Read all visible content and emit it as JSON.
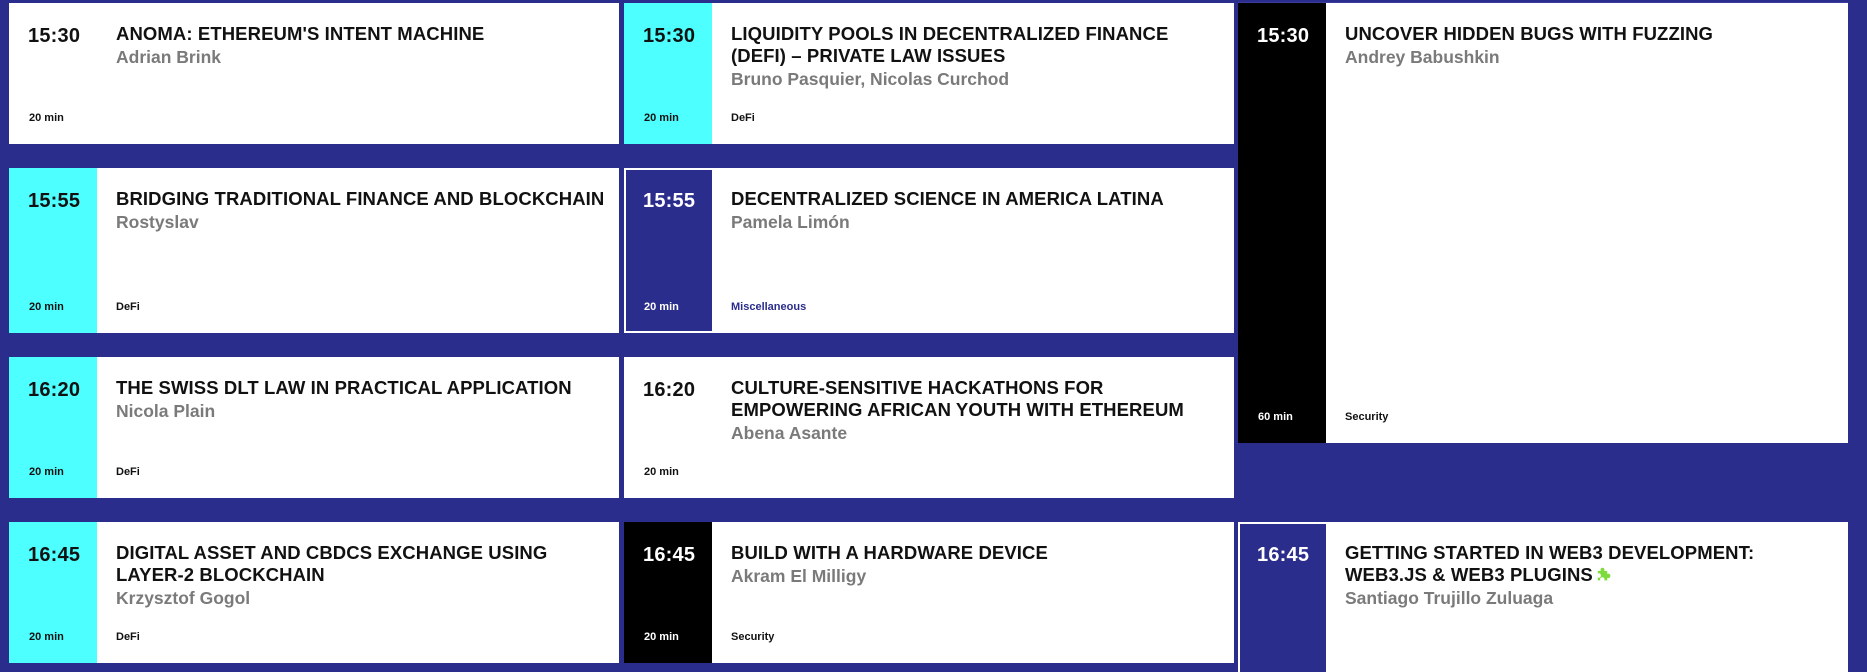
{
  "colors": {
    "background": "#2b2d8c",
    "cyan": "#4dffff",
    "navy": "#2b2d8c",
    "black": "#000000",
    "white": "#ffffff",
    "speaker_gray": "#7a7a7a",
    "puzzle_green": "#7ddc3b"
  },
  "sessions": [
    {
      "time": "15:30",
      "duration": "20 min",
      "title": "ANOMA: ETHEREUM'S INTENT MACHINE",
      "speaker": "Adrian Brink",
      "tag": ""
    },
    {
      "time": "15:30",
      "duration": "20 min",
      "title": "LIQUIDITY POOLS IN DECENTRALIZED FINANCE (DEFI) – PRIVATE LAW ISSUES",
      "speaker": "Bruno Pasquier, Nicolas Curchod",
      "tag": "DeFi"
    },
    {
      "time": "15:30",
      "duration": "60 min",
      "title": "UNCOVER HIDDEN BUGS WITH FUZZING",
      "speaker": "Andrey Babushkin",
      "tag": "Security"
    },
    {
      "time": "15:55",
      "duration": "20 min",
      "title": "BRIDGING TRADITIONAL FINANCE AND BLOCKCHAIN",
      "speaker": "Rostyslav",
      "tag": "DeFi"
    },
    {
      "time": "15:55",
      "duration": "20 min",
      "title": "DECENTRALIZED SCIENCE IN AMERICA LATINA",
      "speaker": "Pamela Limón",
      "tag": "Miscellaneous"
    },
    {
      "time": "16:20",
      "duration": "20 min",
      "title": "THE SWISS DLT LAW IN PRACTICAL APPLICATION",
      "speaker": "Nicola Plain",
      "tag": "DeFi"
    },
    {
      "time": "16:20",
      "duration": "20 min",
      "title": "CULTURE-SENSITIVE HACKATHONS FOR EMPOWERING AFRICAN YOUTH WITH ETHEREUM",
      "speaker": "Abena Asante",
      "tag": ""
    },
    {
      "time": "16:45",
      "duration": "20 min",
      "title": "DIGITAL ASSET AND CBDCS EXCHANGE USING LAYER-2 BLOCKCHAIN",
      "speaker": "Krzysztof Gogol",
      "tag": "DeFi"
    },
    {
      "time": "16:45",
      "duration": "20 min",
      "title": "BUILD WITH A HARDWARE DEVICE",
      "speaker": "Akram El Milligy",
      "tag": "Security"
    },
    {
      "time": "16:45",
      "duration": "",
      "title": "GETTING STARTED IN WEB3 DEVELOPMENT: WEB3.JS & WEB3 PLUGINS",
      "speaker": "Santiago Trujillo Zuluaga",
      "tag": ""
    }
  ]
}
